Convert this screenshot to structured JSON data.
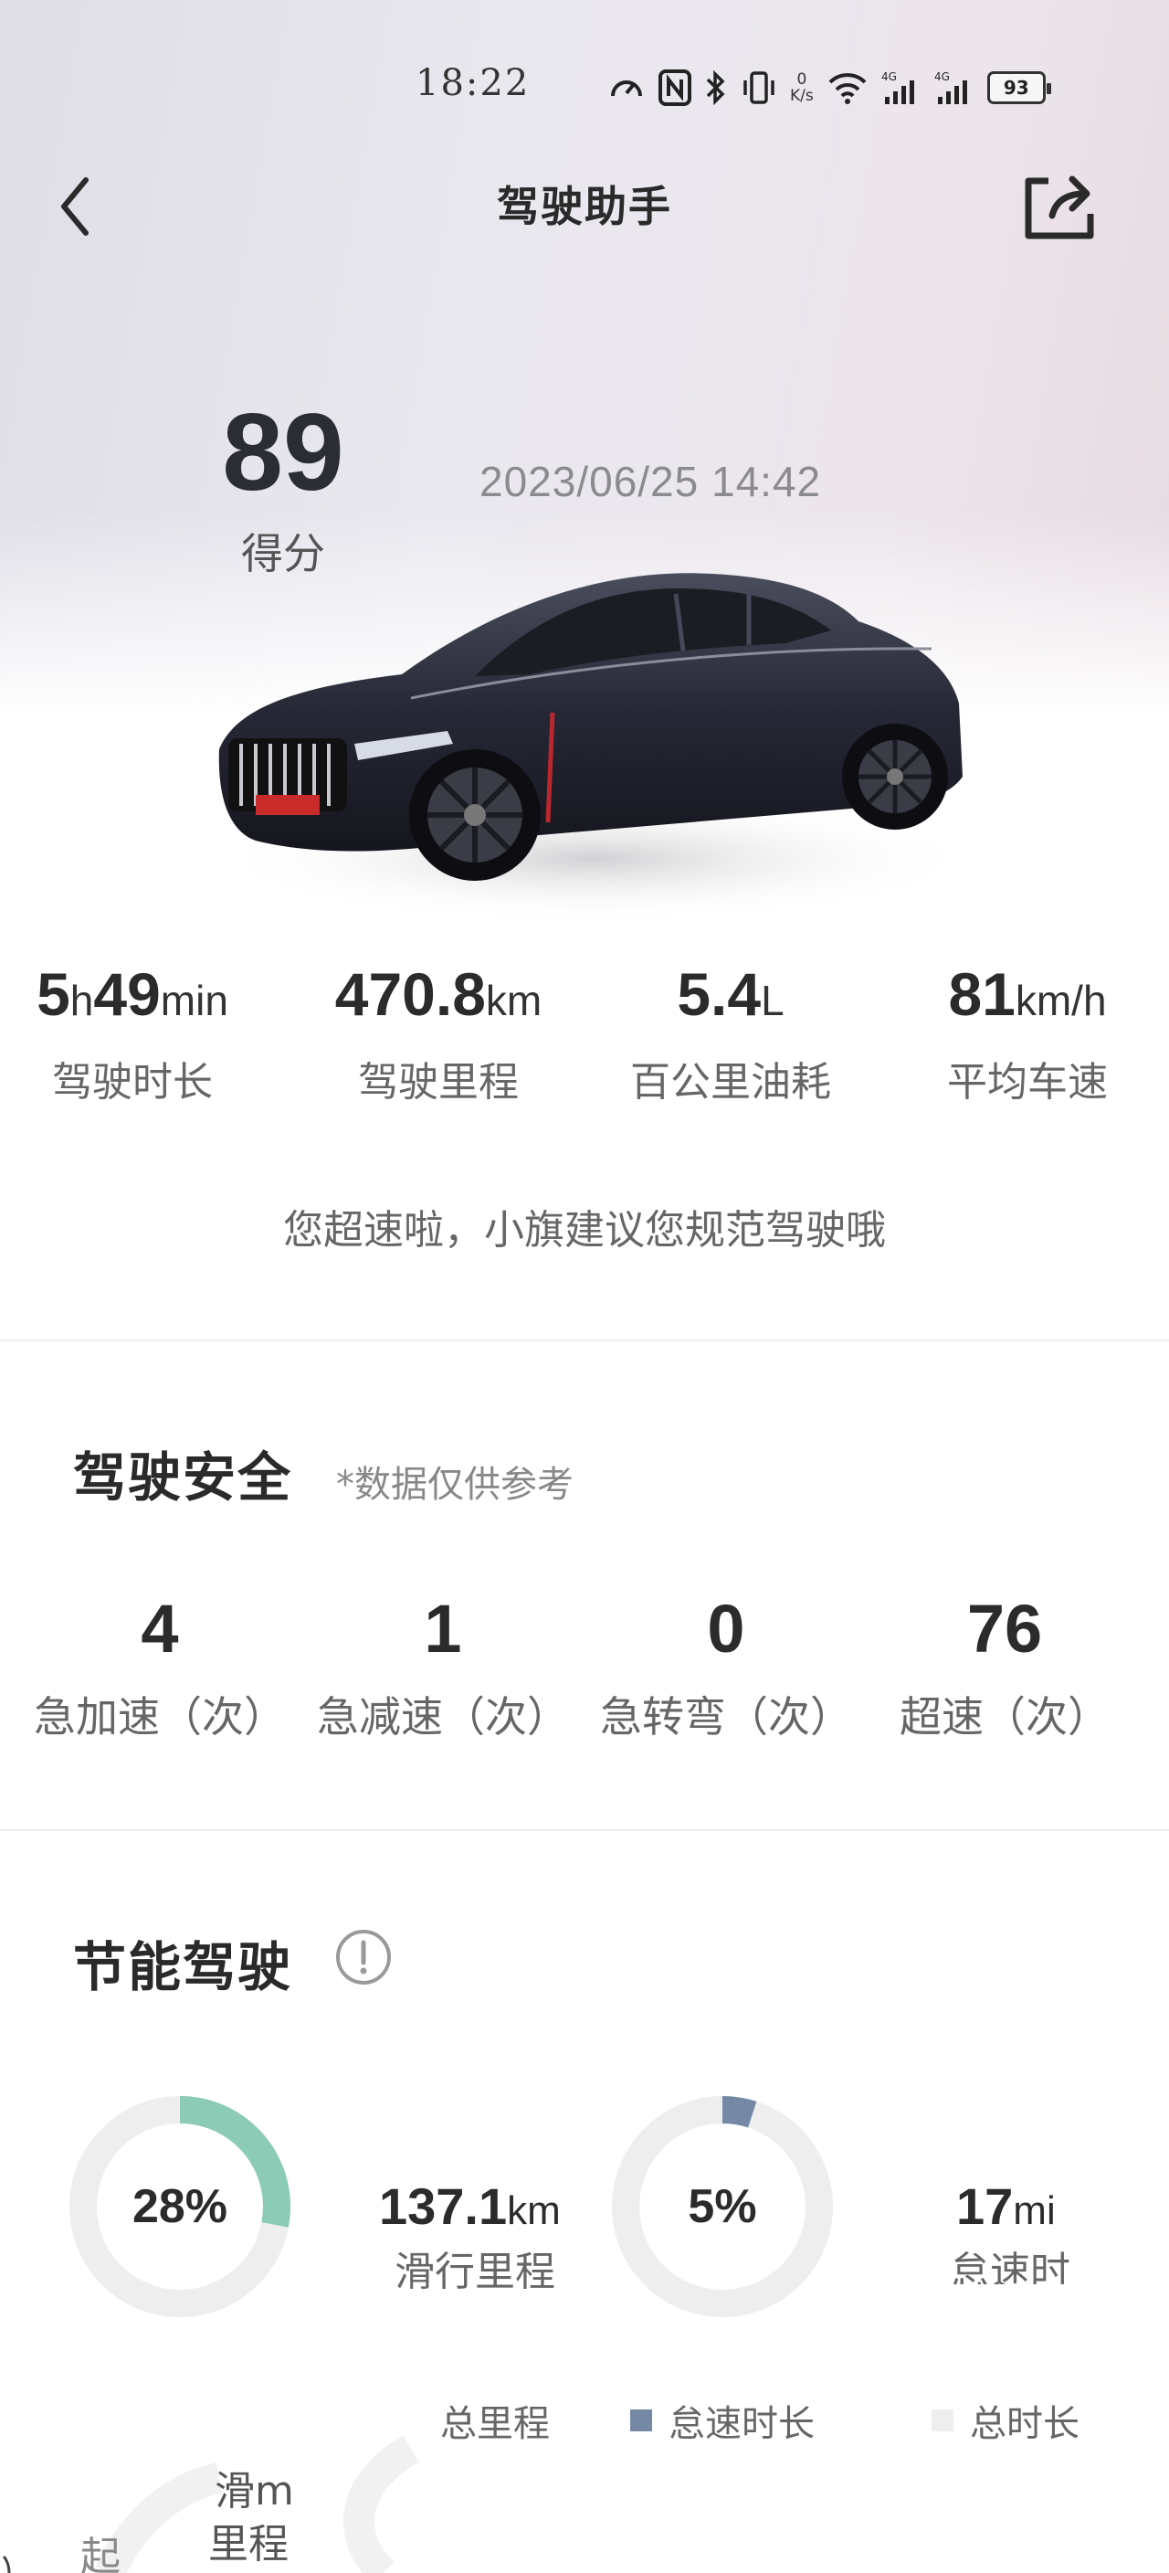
{
  "status_bar": {
    "time": "18:22",
    "net_speed_value": "0",
    "net_speed_unit": "K/s",
    "battery": "93"
  },
  "header": {
    "title": "驾驶助手"
  },
  "score": {
    "value": "89",
    "label": "得分",
    "datetime": "2023/06/25  14:42"
  },
  "trip": [
    {
      "value": "5",
      "unit": "h",
      "value2": "49",
      "unit2": "min",
      "label": "驾驶时长"
    },
    {
      "value": "470.8",
      "unit": "km",
      "label": "驾驶里程"
    },
    {
      "value": "5.4",
      "unit": "L",
      "label": "百公里油耗"
    },
    {
      "value": "81",
      "unit": "km/h",
      "label": "平均车速"
    }
  ],
  "advice": "您超速啦，小旗建议您规范驾驶哦",
  "safety": {
    "title": "驾驶安全",
    "note": "*数据仅供参考",
    "items": [
      {
        "value": "4",
        "label": "急加速（次）"
      },
      {
        "value": "1",
        "label": "急减速（次）"
      },
      {
        "value": "0",
        "label": "急转弯（次）"
      },
      {
        "value": "76",
        "label": "超速（次）"
      }
    ]
  },
  "eco": {
    "title": "节能驾驶",
    "coast_percent": "28%",
    "coast_fraction": 0.28,
    "coast_value": "137.1",
    "coast_unit": "km",
    "coast_label": "滑行里程",
    "idle_percent": "5%",
    "idle_fraction": 0.05,
    "idle_value": "17",
    "idle_unit": "mi",
    "idle_label": "怠速时",
    "legend": [
      {
        "label": "总里程",
        "color": "#ffffff"
      },
      {
        "label": "怠速时长",
        "color": "#7589a6"
      },
      {
        "label": "总时长",
        "color": "#eeeeee"
      }
    ],
    "ghost_coast": "滑m",
    "ghost_mileage": "里程",
    "ghost_fast": "起",
    "colors": {
      "coast": "#8ccbb6",
      "idle": "#7589a6",
      "track": "#eeeeee"
    }
  }
}
